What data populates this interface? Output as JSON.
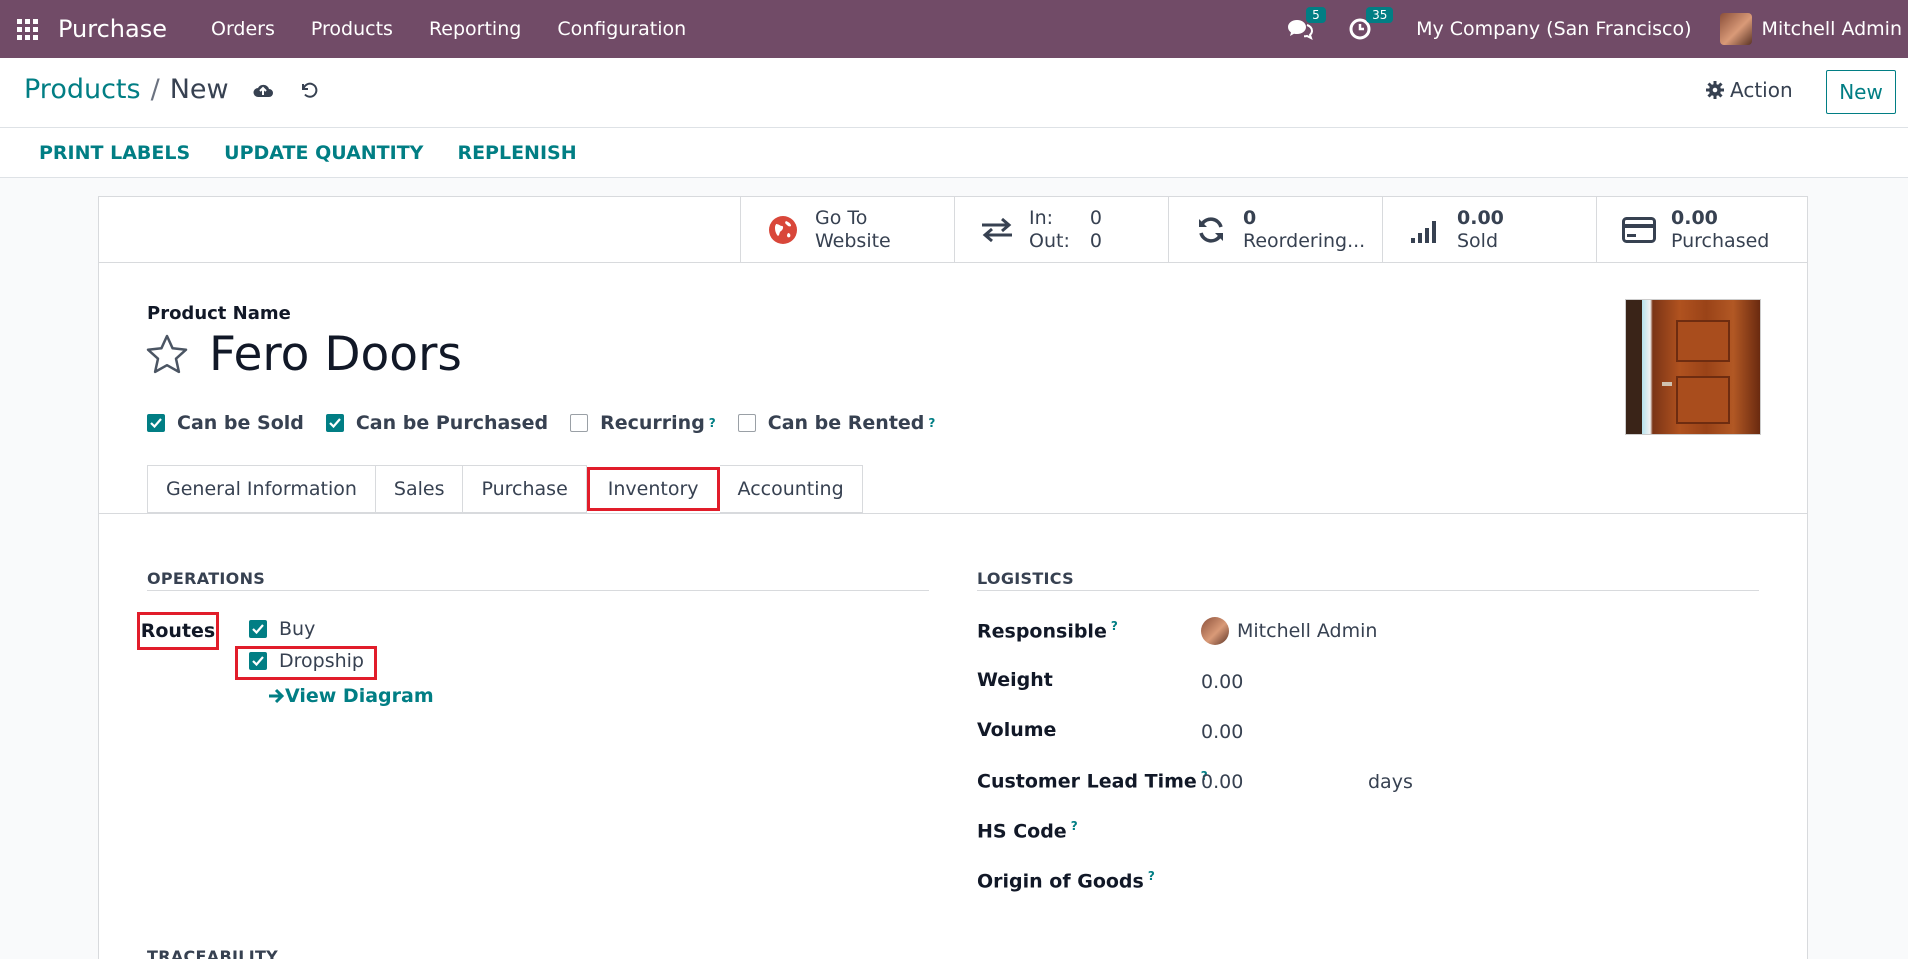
{
  "navbar": {
    "app_name": "Purchase",
    "menu": [
      "Orders",
      "Products",
      "Reporting",
      "Configuration"
    ],
    "messages_count": "5",
    "activities_count": "35",
    "company": "My Company (San Francisco)",
    "user": "Mitchell Admin"
  },
  "control": {
    "breadcrumb_parent": "Products",
    "breadcrumb_separator": "/",
    "breadcrumb_current": "New",
    "action_label": "Action",
    "new_label": "New"
  },
  "statusbar": {
    "buttons": [
      "PRINT LABELS",
      "UPDATE QUANTITY",
      "REPLENISH"
    ]
  },
  "smart_buttons": {
    "website": {
      "line1": "Go To",
      "line2": "Website"
    },
    "moves": {
      "in_label": "In:",
      "in_value": "0",
      "out_label": "Out:",
      "out_value": "0"
    },
    "reordering": {
      "value": "0",
      "label": "Reordering..."
    },
    "sold": {
      "value": "0.00",
      "label": "Sold"
    },
    "purchased": {
      "value": "0.00",
      "label": "Purchased"
    }
  },
  "product": {
    "name_label": "Product Name",
    "name": "Fero Doors",
    "can_be_sold": "Can be Sold",
    "can_be_purchased": "Can be Purchased",
    "recurring": "Recurring",
    "can_be_rented": "Can be Rented",
    "help_mark": "?"
  },
  "tabs": [
    "General Information",
    "Sales",
    "Purchase",
    "Inventory",
    "Accounting"
  ],
  "operations": {
    "title": "OPERATIONS",
    "routes_label": "Routes",
    "routes": [
      "Buy",
      "Dropship"
    ],
    "view_diagram": "View Diagram"
  },
  "logistics": {
    "title": "LOGISTICS",
    "responsible_label": "Responsible",
    "responsible_value": "Mitchell Admin",
    "weight_label": "Weight",
    "weight_value": "0.00",
    "volume_label": "Volume",
    "volume_value": "0.00",
    "lead_time_label": "Customer Lead Time",
    "lead_time_value": "0.00",
    "lead_time_unit": "days",
    "hs_code_label": "HS Code",
    "origin_label": "Origin of Goods"
  },
  "traceability": {
    "title": "TRACEABILITY"
  },
  "colors": {
    "navbar": "#714b67",
    "accent": "#017e84",
    "highlight": "#e11d2a"
  }
}
